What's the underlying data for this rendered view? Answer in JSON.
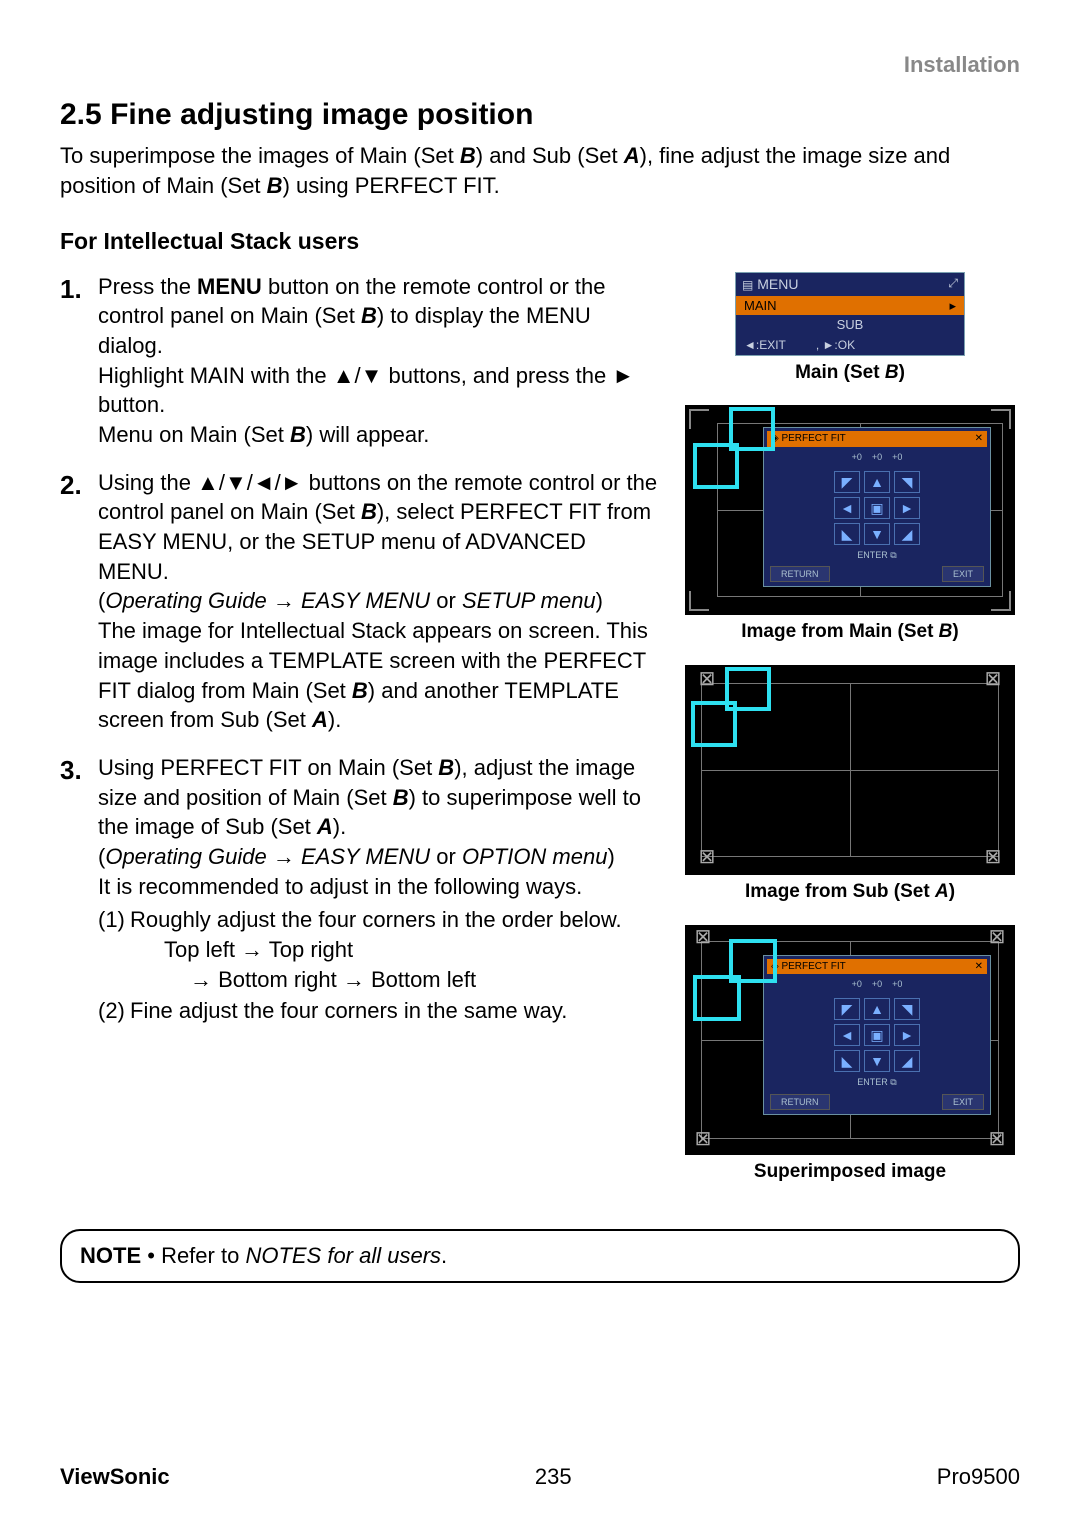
{
  "header": {
    "installation": "Installation"
  },
  "section": {
    "number": "2.5",
    "title": "Fine adjusting image position",
    "intro_1": "To superimpose the images of Main (Set ",
    "intro_b1": "B",
    "intro_2": ") and Sub (Set ",
    "intro_a1": "A",
    "intro_3": "), fine adjust the image size and position of Main (Set ",
    "intro_b2": "B",
    "intro_4": ") using PERFECT FIT."
  },
  "subheading": "For Intellectual Stack users",
  "step1": {
    "num": "1.",
    "p1a": "Press the ",
    "menu": "MENU",
    "p1b": " button on the remote control or the control panel on Main (Set ",
    "b1": "B",
    "p1c": ") to display the MENU dialog.",
    "p2a": "Highlight MAIN with the ▲/▼ buttons, and press the ► button.",
    "p3a": "Menu on Main (Set ",
    "b2": "B",
    "p3b": ") will appear."
  },
  "step2": {
    "num": "2.",
    "p1a": "Using the ▲/▼/◄/► buttons on the remote control or the control panel on Main (Set ",
    "b1": "B",
    "p1b": "), select PERFECT FIT from EASY MENU, or the SETUP menu of ADVANCED MENU.",
    "guide_open": "(",
    "guide1": "Operating Guide",
    "arrow": " → ",
    "guide2": "EASY MENU",
    "or": " or ",
    "guide3": "SETUP menu",
    "guide_close": ")",
    "p2a": "The image for Intellectual Stack appears on screen.  This image includes a TEMPLATE screen with the PERFECT FIT dialog from Main (Set ",
    "b2": "B",
    "p2b": ") and another TEMPLATE screen from Sub (Set ",
    "a1": "A",
    "p2c": ")."
  },
  "step3": {
    "num": "3.",
    "p1a": "Using PERFECT FIT on Main (Set ",
    "b1": "B",
    "p1b": "), adjust the image size and position of Main (Set ",
    "b2": "B",
    "p1c": ") to superimpose well to the image of Sub (Set ",
    "a1": "A",
    "p1d": ").",
    "guide_open": "(",
    "guide1": "Operating Guide",
    "arrow": " → ",
    "guide2": "EASY MENU",
    "or": " or ",
    "guide3": "OPTION menu",
    "guide_close": ")",
    "p2": "It is recommended to adjust in the following ways.",
    "s1n": "(1)",
    "s1a": "Roughly adjust the four corners in the order below.",
    "s1b": "Top left → Top right",
    "s1c": "→ Bottom right → Bottom left",
    "s2n": "(2)",
    "s2": "Fine adjust the four corners in the same way."
  },
  "note": {
    "label": "NOTE",
    "bullet": " • ",
    "text1": "Refer to ",
    "em": "NOTES for all users",
    "text2": "."
  },
  "figures": {
    "menu_title": "MENU",
    "menu_main": "MAIN",
    "menu_sub": "SUB",
    "menu_exit": "◄:EXIT",
    "menu_ok": ", ►:OK",
    "cap1a": "Main (Set ",
    "cap1b": "B",
    "cap1c": ")",
    "pf_title": "PERFECT FIT",
    "pf_h1": "+0",
    "pf_h2": "+0",
    "pf_h3": "+0",
    "pf_enter_label": "ENTER",
    "pf_return": "RETURN",
    "pf_exit": "EXIT",
    "cap2a": "Image from Main (Set ",
    "cap2b": "B",
    "cap2c": ")",
    "cap3a": "Image from Sub (Set ",
    "cap3b": "A",
    "cap3c": ")",
    "cap4": "Superimposed image"
  },
  "footer": {
    "left": "ViewSonic",
    "center": "235",
    "right": "Pro9500"
  }
}
